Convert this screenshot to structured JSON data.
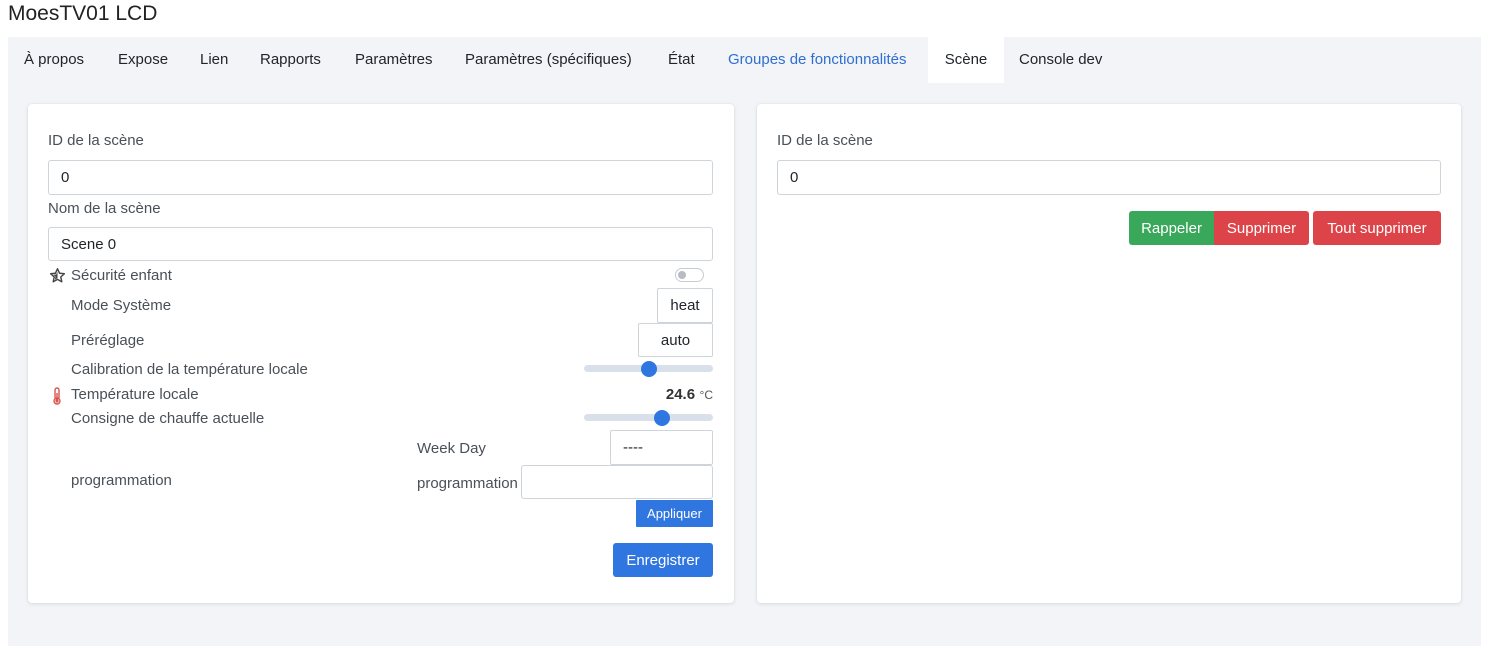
{
  "page": {
    "title": "MoesTV01 LCD"
  },
  "tabs": [
    {
      "label": "À propos"
    },
    {
      "label": "Expose"
    },
    {
      "label": "Lien"
    },
    {
      "label": "Rapports"
    },
    {
      "label": "Paramètres"
    },
    {
      "label": "Paramètres (spécifiques)"
    },
    {
      "label": "État"
    },
    {
      "label": "Groupes de fonctionnalités"
    },
    {
      "label": "Scène"
    },
    {
      "label": "Console dev"
    }
  ],
  "active_tab": "Scène",
  "left_card": {
    "scene_id_label": "ID de la scène",
    "scene_id_value": "0",
    "scene_name_label": "Nom de la scène",
    "scene_name_value": "Scene 0",
    "child_lock_label": "Sécurité enfant",
    "child_lock_on": false,
    "system_mode_label": "Mode Système",
    "system_mode_value": "heat",
    "preset_label": "Préréglage",
    "preset_value": "auto",
    "calibration_label": "Calibration de la température locale",
    "calibration_slider_fraction": 0.5,
    "local_temp_label": "Température locale",
    "local_temp_value": "24.6",
    "local_temp_unit": "°C",
    "heating_setpoint_label": "Consigne de chauffe actuelle",
    "heating_setpoint_slider_fraction": 0.62,
    "schedule_label": "programmation",
    "week_day_label": "Week Day",
    "week_day_value": "----",
    "schedule_sub_label": "programmation",
    "schedule_value": "",
    "apply_button": "Appliquer",
    "save_button": "Enregistrer"
  },
  "right_card": {
    "scene_id_label": "ID de la scène",
    "scene_id_value": "0",
    "recall_button": "Rappeler",
    "remove_button": "Supprimer",
    "remove_all_button": "Tout supprimer"
  },
  "colors": {
    "primary": "#2f76e0",
    "success": "#3aa85b",
    "danger": "#dc4449",
    "link": "#2f6fd0",
    "thermometer": "#d9534f"
  },
  "icons": {
    "child_lock": "star-icon",
    "local_temperature": "thermometer-icon"
  }
}
